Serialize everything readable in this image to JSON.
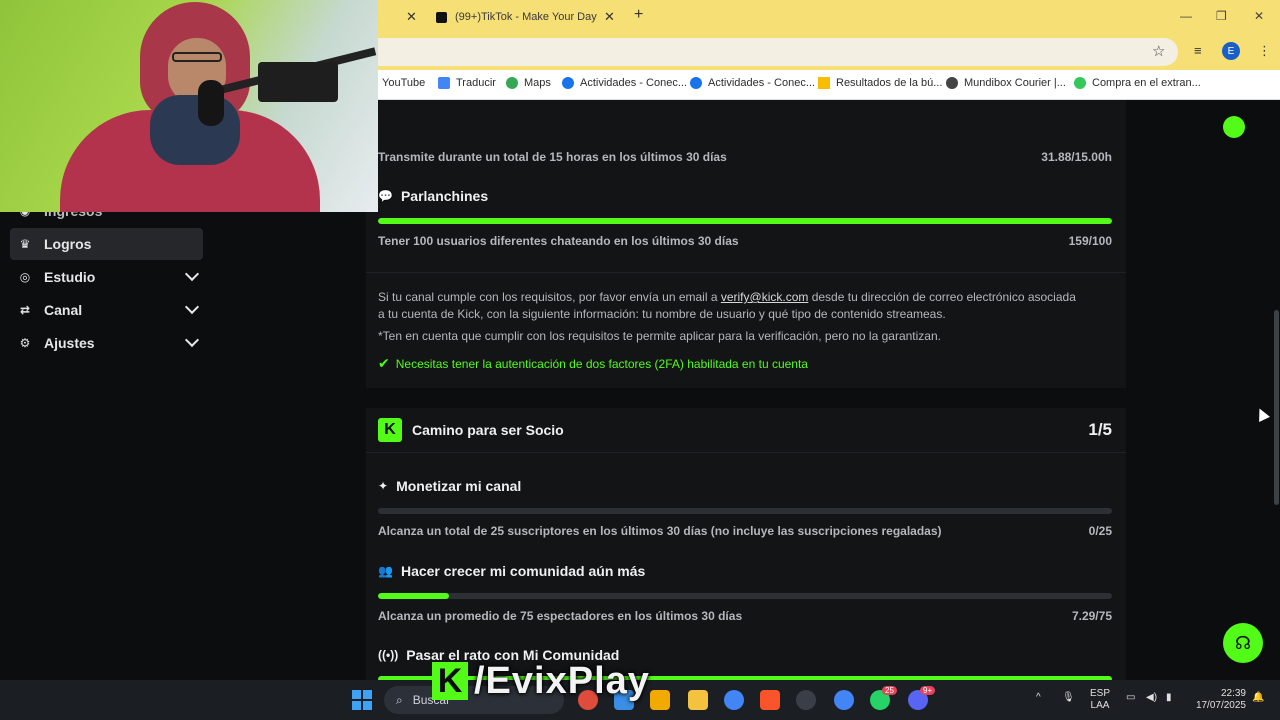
{
  "browser": {
    "tabs": [
      {
        "label": ""
      },
      {
        "label": "(99+)TikTok - Make Your Day"
      }
    ],
    "tab_close_glyph": "✕",
    "new_tab_glyph": "+",
    "window_controls": {
      "minimize": "—",
      "maximize": "❐",
      "close": "✕"
    },
    "profile_initial": "E",
    "bookmarks": [
      {
        "label": "YouTube",
        "color": "#ff0000"
      },
      {
        "label": "Traducir",
        "color": "#4285f4"
      },
      {
        "label": "Maps",
        "color": "#34a853"
      },
      {
        "label": "Actividades - Conec...",
        "color": "#1a73e8"
      },
      {
        "label": "Actividades - Conec...",
        "color": "#1a73e8"
      },
      {
        "label": "Resultados de la bú...",
        "color": "#fbbc05"
      },
      {
        "label": "Mundibox Courier |...",
        "color": "#444444"
      },
      {
        "label": "Compra en el extran...",
        "color": "#34c759"
      }
    ]
  },
  "sidebar": {
    "items": [
      {
        "label": "Ingresos",
        "icon": "coins-icon",
        "glyph": "◉"
      },
      {
        "label": "Logros",
        "icon": "trophy-icon",
        "glyph": "🏆"
      },
      {
        "label": "Estudio",
        "icon": "studio-icon",
        "glyph": "◎"
      },
      {
        "label": "Canal",
        "icon": "channel-icon",
        "glyph": "⇄"
      },
      {
        "label": "Ajustes",
        "icon": "gear-icon",
        "glyph": "⚙"
      }
    ]
  },
  "verification": {
    "hours_req": "Transmite durante un total de 15 horas en los últimos 30 días",
    "hours_val": "31.88/15.00h",
    "chatters_title": "Parlanchines",
    "chatters_progress": 1.0,
    "chatters_req": "Tener 100 usuarios diferentes chateando en los últimos 30 días",
    "chatters_val": "159/100",
    "info_pre": "Si tu canal cumple con los requisitos, por favor envía un email a ",
    "info_email": "verify@kick.com",
    "info_post": " desde tu dirección de correo electrónico asociada",
    "info_line2": "a tu cuenta de Kick, con la siguiente información: tu nombre de usuario y qué tipo de contenido streameas.",
    "note": "*Ten en cuenta que cumplir con los requisitos te permite aplicar para la verificación, pero no la garantizan.",
    "twofa": "Necesitas tener la autenticación de dos factores (2FA) habilitada en tu cuenta"
  },
  "partner": {
    "title": "Camino para ser Socio",
    "count": "1/5",
    "logo_letter": "K",
    "req1_title": "Monetizar mi canal",
    "req1_progress": 0.0,
    "req1_text": "Alcanza un total de 25 suscriptores en los últimos 30 días (no incluye las suscripciones regaladas)",
    "req1_val": "0/25",
    "req2_title": "Hacer crecer mi comunidad aún más",
    "req2_progress": 0.0972,
    "req2_text": "Alcanza un promedio de 75 espectadores en los últimos 30 días",
    "req2_val": "7.29/75",
    "req3_title": "Pasar el rato con Mi Comunidad"
  },
  "watermark": {
    "k": "K",
    "text": "/EvixPlay"
  },
  "taskbar": {
    "search_label": "Buscar",
    "lang1": "ESP",
    "lang2": "LAA",
    "time": "22:39",
    "date": "17/07/2025",
    "badge_whatsapp": "25",
    "badge_discord": "9+"
  },
  "colors": {
    "accent": "#53fc18",
    "tabbar": "#f6df74"
  }
}
